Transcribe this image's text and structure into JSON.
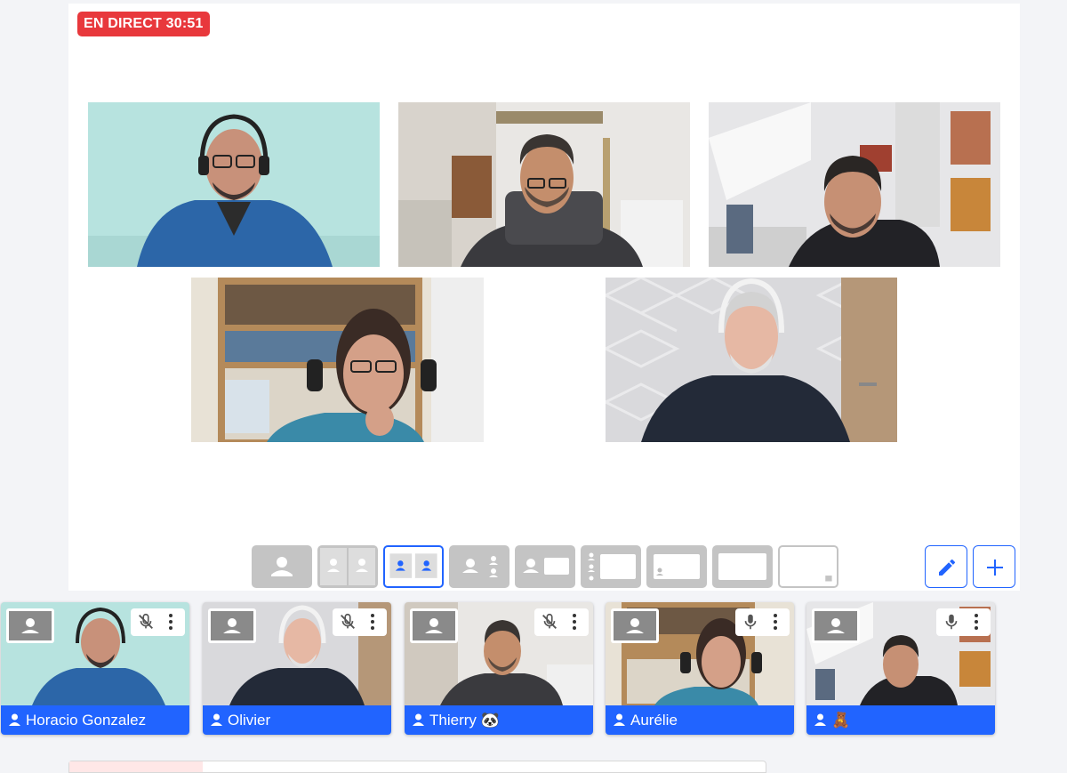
{
  "live_badge": "EN DIRECT 30:51",
  "stage_videos": [
    {
      "id": "horacio"
    },
    {
      "id": "thierry"
    },
    {
      "id": "speaker3"
    },
    {
      "id": "aurelie"
    },
    {
      "id": "olivier"
    }
  ],
  "layouts": [
    "single",
    "two-side-by-side",
    "two-side-by-side-selected",
    "main-plus-two",
    "speaker-plus-screen",
    "people-list-plus-screen",
    "screen-with-small-speaker",
    "screen-only",
    "screen-with-tiny-corner"
  ],
  "selected_layout": "two-side-by-side-selected",
  "actions": {
    "edit_icon": "pencil-icon",
    "add_icon": "plus-icon"
  },
  "participants": [
    {
      "name": "Horacio Gonzalez",
      "mic": "muted"
    },
    {
      "name": "Olivier",
      "mic": "muted"
    },
    {
      "name": "Thierry 🐼",
      "mic": "muted"
    },
    {
      "name": "Aurélie",
      "mic": "on"
    },
    {
      "name": "🧸",
      "mic": "on"
    }
  ],
  "colors": {
    "accent": "#2164ff",
    "live": "#e8383c",
    "inactive": "#c4c4c4"
  }
}
